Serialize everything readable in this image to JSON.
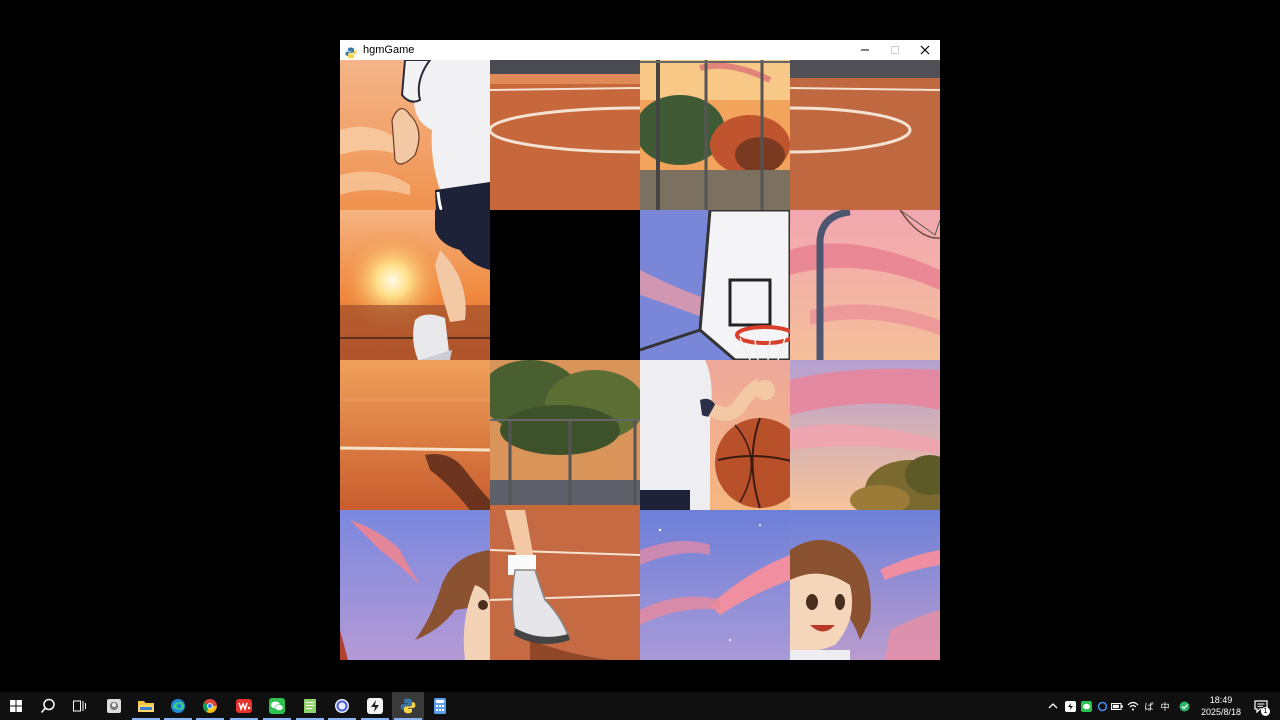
{
  "window": {
    "title": "hgmGame",
    "app_icon": "python-icon",
    "controls": [
      "minimize-icon",
      "maximize-icon",
      "close-icon"
    ]
  },
  "puzzle": {
    "type": "sliding-tile-puzzle",
    "grid": "4x4",
    "empty_tile": "row 2, column 2",
    "tiles": [
      {
        "row": 1,
        "col": 1,
        "depicts": "girl-running-torso-and-sun"
      },
      {
        "row": 1,
        "col": 2,
        "depicts": "court-center-circle-left"
      },
      {
        "row": 1,
        "col": 3,
        "depicts": "fence-and-trees-at-sunset"
      },
      {
        "row": 1,
        "col": 4,
        "depicts": "court-center-circle-right"
      },
      {
        "row": 2,
        "col": 1,
        "depicts": "setting-sun-and-running-leg"
      },
      {
        "row": 2,
        "col": 2,
        "depicts": "empty"
      },
      {
        "row": 2,
        "col": 3,
        "depicts": "basketball-backboard"
      },
      {
        "row": 2,
        "col": 4,
        "depicts": "hoop-pole-and-pink-clouds"
      },
      {
        "row": 3,
        "col": 1,
        "depicts": "court-floor-with-shadow"
      },
      {
        "row": 3,
        "col": 2,
        "depicts": "trees-behind-fence"
      },
      {
        "row": 3,
        "col": 3,
        "depicts": "arm-dribbling-basketball"
      },
      {
        "row": 3,
        "col": 4,
        "depicts": "pink-clouds-and-bushes"
      },
      {
        "row": 4,
        "col": 1,
        "depicts": "girl-hair-left"
      },
      {
        "row": 4,
        "col": 2,
        "depicts": "sneaker-on-court"
      },
      {
        "row": 4,
        "col": 3,
        "depicts": "twilight-sky"
      },
      {
        "row": 4,
        "col": 4,
        "depicts": "smiling-girl-face"
      }
    ]
  },
  "taskbar": {
    "start_icon": "windows-start-icon",
    "pinned": [
      "search-icon",
      "task-view-icon",
      "photo-viewer-icon",
      "file-explorer-icon",
      "edge-icon",
      "chrome-icon",
      "wps-icon",
      "wechat-icon",
      "notepad-icon",
      "browser-icon",
      "app-icon",
      "python-game-icon",
      "calculator-icon"
    ],
    "tray": {
      "ime_label": "中",
      "volume_label": "ぱ"
    },
    "clock": {
      "time": "18:49",
      "date": "2025/8/18"
    },
    "notification_count": "1"
  },
  "colors": {
    "window_title_bg": "#ffffff",
    "taskbar_bg": "#101010",
    "sunset_orange": "#f08a4b",
    "court": "#c96a3e",
    "sky_blue": "#7f8fe0",
    "cloud_pink": "#ef9a9a"
  }
}
